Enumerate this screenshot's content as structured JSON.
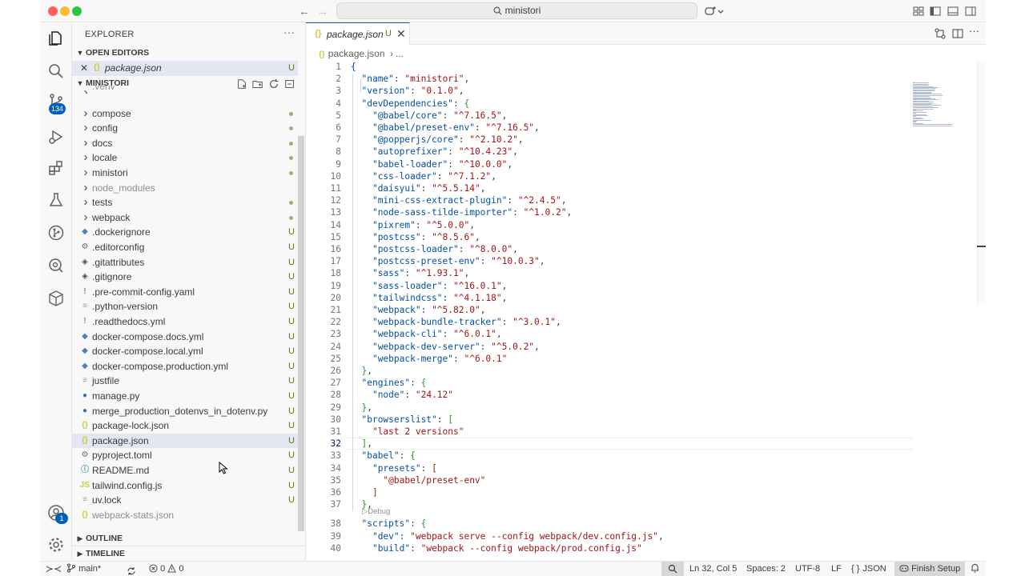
{
  "titlebar": {
    "search_text": "ministori"
  },
  "activity_bar": {
    "scm_badge": "134",
    "accounts_badge": "1"
  },
  "sidebar": {
    "title": "EXPLORER",
    "open_editors_label": "OPEN EDITORS",
    "open_editor_file": "package.json",
    "open_editor_status": "U",
    "folder_label": "MINISTORI",
    "items": [
      {
        "name": ".venv",
        "type": "folder",
        "status": ""
      },
      {
        "name": "compose",
        "type": "folder",
        "status": "dot"
      },
      {
        "name": "config",
        "type": "folder",
        "status": "dot"
      },
      {
        "name": "docs",
        "type": "folder",
        "status": "dot"
      },
      {
        "name": "locale",
        "type": "folder",
        "status": "dot"
      },
      {
        "name": "ministori",
        "type": "folder",
        "status": "dot"
      },
      {
        "name": "node_modules",
        "type": "folder",
        "status": ""
      },
      {
        "name": "tests",
        "type": "folder",
        "status": "dot"
      },
      {
        "name": "webpack",
        "type": "folder",
        "status": "dot"
      },
      {
        "name": ".dockerignore",
        "type": "docker",
        "status": "U"
      },
      {
        "name": ".editorconfig",
        "type": "gear",
        "status": "U"
      },
      {
        "name": ".gitattributes",
        "type": "git",
        "status": "U"
      },
      {
        "name": ".gitignore",
        "type": "git",
        "status": "U"
      },
      {
        "name": ".pre-commit-config.yaml",
        "type": "yaml",
        "status": "U"
      },
      {
        "name": ".python-version",
        "type": "text",
        "status": "U"
      },
      {
        "name": ".readthedocs.yml",
        "type": "yaml",
        "status": "U"
      },
      {
        "name": "docker-compose.docs.yml",
        "type": "docker",
        "status": "U"
      },
      {
        "name": "docker-compose.local.yml",
        "type": "docker",
        "status": "U"
      },
      {
        "name": "docker-compose.production.yml",
        "type": "docker",
        "status": "U"
      },
      {
        "name": "justfile",
        "type": "text",
        "status": "U"
      },
      {
        "name": "manage.py",
        "type": "python",
        "status": "U"
      },
      {
        "name": "merge_production_dotenvs_in_dotenv.py",
        "type": "python",
        "status": "U"
      },
      {
        "name": "package-lock.json",
        "type": "json",
        "status": "U"
      },
      {
        "name": "package.json",
        "type": "json",
        "status": "U"
      },
      {
        "name": "pyproject.toml",
        "type": "gear",
        "status": "U"
      },
      {
        "name": "README.md",
        "type": "info",
        "status": "U"
      },
      {
        "name": "tailwind.config.js",
        "type": "js",
        "status": "U"
      },
      {
        "name": "uv.lock",
        "type": "text",
        "status": "U"
      },
      {
        "name": "webpack-stats.json",
        "type": "json",
        "status": ""
      }
    ],
    "outline_label": "OUTLINE",
    "timeline_label": "TIMELINE"
  },
  "editor": {
    "tab_label": "package.json",
    "tab_status": "U",
    "breadcrumb_file": "package.json",
    "breadcrumb_more": "...",
    "codelens_debug": "Debug",
    "lines": [
      {
        "n": "1",
        "segs": [
          [
            "br1",
            "{"
          ]
        ]
      },
      {
        "n": "2",
        "segs": [
          [
            "",
            "  "
          ],
          [
            "k",
            "\"name\""
          ],
          [
            "",
            ": "
          ],
          [
            "s",
            "\"ministori\""
          ],
          [
            "",
            ","
          ]
        ]
      },
      {
        "n": "3",
        "segs": [
          [
            "",
            "  "
          ],
          [
            "k",
            "\"version\""
          ],
          [
            "",
            ": "
          ],
          [
            "s",
            "\"0.1.0\""
          ],
          [
            "",
            ","
          ]
        ]
      },
      {
        "n": "4",
        "segs": [
          [
            "",
            "  "
          ],
          [
            "k",
            "\"devDependencies\""
          ],
          [
            "",
            ": "
          ],
          [
            "br2",
            "{"
          ]
        ]
      },
      {
        "n": "5",
        "segs": [
          [
            "",
            "    "
          ],
          [
            "k",
            "\"@babel/core\""
          ],
          [
            "",
            ": "
          ],
          [
            "s",
            "\"^7.16.5\""
          ],
          [
            "",
            ","
          ]
        ]
      },
      {
        "n": "6",
        "segs": [
          [
            "",
            "    "
          ],
          [
            "k",
            "\"@babel/preset-env\""
          ],
          [
            "",
            ": "
          ],
          [
            "s",
            "\"^7.16.5\""
          ],
          [
            "",
            ","
          ]
        ]
      },
      {
        "n": "7",
        "segs": [
          [
            "",
            "    "
          ],
          [
            "k",
            "\"@popperjs/core\""
          ],
          [
            "",
            ": "
          ],
          [
            "s",
            "\"^2.10.2\""
          ],
          [
            "",
            ","
          ]
        ]
      },
      {
        "n": "8",
        "segs": [
          [
            "",
            "    "
          ],
          [
            "k",
            "\"autoprefixer\""
          ],
          [
            "",
            ": "
          ],
          [
            "s",
            "\"^10.4.23\""
          ],
          [
            "",
            ","
          ]
        ]
      },
      {
        "n": "9",
        "segs": [
          [
            "",
            "    "
          ],
          [
            "k",
            "\"babel-loader\""
          ],
          [
            "",
            ": "
          ],
          [
            "s",
            "\"^10.0.0\""
          ],
          [
            "",
            ","
          ]
        ]
      },
      {
        "n": "10",
        "segs": [
          [
            "",
            "    "
          ],
          [
            "k",
            "\"css-loader\""
          ],
          [
            "",
            ": "
          ],
          [
            "s",
            "\"^7.1.2\""
          ],
          [
            "",
            ","
          ]
        ]
      },
      {
        "n": "11",
        "segs": [
          [
            "",
            "    "
          ],
          [
            "k",
            "\"daisyui\""
          ],
          [
            "",
            ": "
          ],
          [
            "s",
            "\"^5.5.14\""
          ],
          [
            "",
            ","
          ]
        ]
      },
      {
        "n": "12",
        "segs": [
          [
            "",
            "    "
          ],
          [
            "k",
            "\"mini-css-extract-plugin\""
          ],
          [
            "",
            ": "
          ],
          [
            "s",
            "\"^2.4.5\""
          ],
          [
            "",
            ","
          ]
        ]
      },
      {
        "n": "13",
        "segs": [
          [
            "",
            "    "
          ],
          [
            "k",
            "\"node-sass-tilde-importer\""
          ],
          [
            "",
            ": "
          ],
          [
            "s",
            "\"^1.0.2\""
          ],
          [
            "",
            ","
          ]
        ]
      },
      {
        "n": "14",
        "segs": [
          [
            "",
            "    "
          ],
          [
            "k",
            "\"pixrem\""
          ],
          [
            "",
            ": "
          ],
          [
            "s",
            "\"^5.0.0\""
          ],
          [
            "",
            ","
          ]
        ]
      },
      {
        "n": "15",
        "segs": [
          [
            "",
            "    "
          ],
          [
            "k",
            "\"postcss\""
          ],
          [
            "",
            ": "
          ],
          [
            "s",
            "\"^8.5.6\""
          ],
          [
            "",
            ","
          ]
        ]
      },
      {
        "n": "16",
        "segs": [
          [
            "",
            "    "
          ],
          [
            "k",
            "\"postcss-loader\""
          ],
          [
            "",
            ": "
          ],
          [
            "s",
            "\"^8.0.0\""
          ],
          [
            "",
            ","
          ]
        ]
      },
      {
        "n": "17",
        "segs": [
          [
            "",
            "    "
          ],
          [
            "k",
            "\"postcss-preset-env\""
          ],
          [
            "",
            ": "
          ],
          [
            "s",
            "\"^10.0.3\""
          ],
          [
            "",
            ","
          ]
        ]
      },
      {
        "n": "18",
        "segs": [
          [
            "",
            "    "
          ],
          [
            "k",
            "\"sass\""
          ],
          [
            "",
            ": "
          ],
          [
            "s",
            "\"^1.93.1\""
          ],
          [
            "",
            ","
          ]
        ]
      },
      {
        "n": "19",
        "segs": [
          [
            "",
            "    "
          ],
          [
            "k",
            "\"sass-loader\""
          ],
          [
            "",
            ": "
          ],
          [
            "s",
            "\"^16.0.1\""
          ],
          [
            "",
            ","
          ]
        ]
      },
      {
        "n": "20",
        "segs": [
          [
            "",
            "    "
          ],
          [
            "k",
            "\"tailwindcss\""
          ],
          [
            "",
            ": "
          ],
          [
            "s",
            "\"^4.1.18\""
          ],
          [
            "",
            ","
          ]
        ]
      },
      {
        "n": "21",
        "segs": [
          [
            "",
            "    "
          ],
          [
            "k",
            "\"webpack\""
          ],
          [
            "",
            ": "
          ],
          [
            "s",
            "\"^5.82.0\""
          ],
          [
            "",
            ","
          ]
        ]
      },
      {
        "n": "22",
        "segs": [
          [
            "",
            "    "
          ],
          [
            "k",
            "\"webpack-bundle-tracker\""
          ],
          [
            "",
            ": "
          ],
          [
            "s",
            "\"^3.0.1\""
          ],
          [
            "",
            ","
          ]
        ]
      },
      {
        "n": "23",
        "segs": [
          [
            "",
            "    "
          ],
          [
            "k",
            "\"webpack-cli\""
          ],
          [
            "",
            ": "
          ],
          [
            "s",
            "\"^6.0.1\""
          ],
          [
            "",
            ","
          ]
        ]
      },
      {
        "n": "24",
        "segs": [
          [
            "",
            "    "
          ],
          [
            "k",
            "\"webpack-dev-server\""
          ],
          [
            "",
            ": "
          ],
          [
            "s",
            "\"^5.0.2\""
          ],
          [
            "",
            ","
          ]
        ]
      },
      {
        "n": "25",
        "segs": [
          [
            "",
            "    "
          ],
          [
            "k",
            "\"webpack-merge\""
          ],
          [
            "",
            ": "
          ],
          [
            "s",
            "\"^6.0.1\""
          ]
        ]
      },
      {
        "n": "26",
        "segs": [
          [
            "",
            "  "
          ],
          [
            "br2",
            "}"
          ],
          [
            "",
            ","
          ]
        ]
      },
      {
        "n": "27",
        "segs": [
          [
            "",
            "  "
          ],
          [
            "k",
            "\"engines\""
          ],
          [
            "",
            ": "
          ],
          [
            "br2",
            "{"
          ]
        ]
      },
      {
        "n": "28",
        "segs": [
          [
            "",
            "    "
          ],
          [
            "k",
            "\"node\""
          ],
          [
            "",
            ": "
          ],
          [
            "s",
            "\"24.12\""
          ]
        ]
      },
      {
        "n": "29",
        "segs": [
          [
            "",
            "  "
          ],
          [
            "br2",
            "}"
          ],
          [
            "",
            ","
          ]
        ]
      },
      {
        "n": "30",
        "segs": [
          [
            "",
            "  "
          ],
          [
            "k",
            "\"browserslist\""
          ],
          [
            "",
            ": "
          ],
          [
            "br2",
            "["
          ]
        ]
      },
      {
        "n": "31",
        "segs": [
          [
            "",
            "    "
          ],
          [
            "s",
            "\"last 2 versions\""
          ]
        ]
      },
      {
        "n": "32",
        "segs": [
          [
            "",
            "  "
          ],
          [
            "br2",
            "]"
          ],
          [
            "",
            ","
          ]
        ]
      },
      {
        "n": "33",
        "segs": [
          [
            "",
            "  "
          ],
          [
            "k",
            "\"babel\""
          ],
          [
            "",
            ": "
          ],
          [
            "br2",
            "{"
          ]
        ]
      },
      {
        "n": "34",
        "segs": [
          [
            "",
            "    "
          ],
          [
            "k",
            "\"presets\""
          ],
          [
            "",
            ": "
          ],
          [
            "br3",
            "["
          ]
        ]
      },
      {
        "n": "35",
        "segs": [
          [
            "",
            "      "
          ],
          [
            "s",
            "\"@babel/preset-env\""
          ]
        ]
      },
      {
        "n": "36",
        "segs": [
          [
            "",
            "    "
          ],
          [
            "br3",
            "]"
          ]
        ]
      },
      {
        "n": "37",
        "segs": [
          [
            "",
            "  "
          ],
          [
            "br2",
            "}"
          ],
          [
            "",
            ","
          ]
        ]
      },
      {
        "n": "38",
        "segs": [
          [
            "",
            "  "
          ],
          [
            "k",
            "\"scripts\""
          ],
          [
            "",
            ": "
          ],
          [
            "br2",
            "{"
          ]
        ]
      },
      {
        "n": "39",
        "segs": [
          [
            "",
            "    "
          ],
          [
            "k",
            "\"dev\""
          ],
          [
            "",
            ": "
          ],
          [
            "s",
            "\"webpack serve --config webpack/dev.config.js\""
          ],
          [
            "",
            ","
          ]
        ]
      },
      {
        "n": "40",
        "segs": [
          [
            "",
            "    "
          ],
          [
            "k",
            "\"build\""
          ],
          [
            "",
            ": "
          ],
          [
            "s",
            "\"webpack --config webpack/prod.config.js\""
          ]
        ]
      }
    ]
  },
  "statusbar": {
    "branch": "main*",
    "errors": "0",
    "warnings": "0",
    "cursor_position": "Ln 32, Col 5",
    "indentation": "Spaces: 2",
    "encoding": "UTF-8",
    "eol": "LF",
    "language": "JSON",
    "finish_setup": "Finish Setup"
  }
}
